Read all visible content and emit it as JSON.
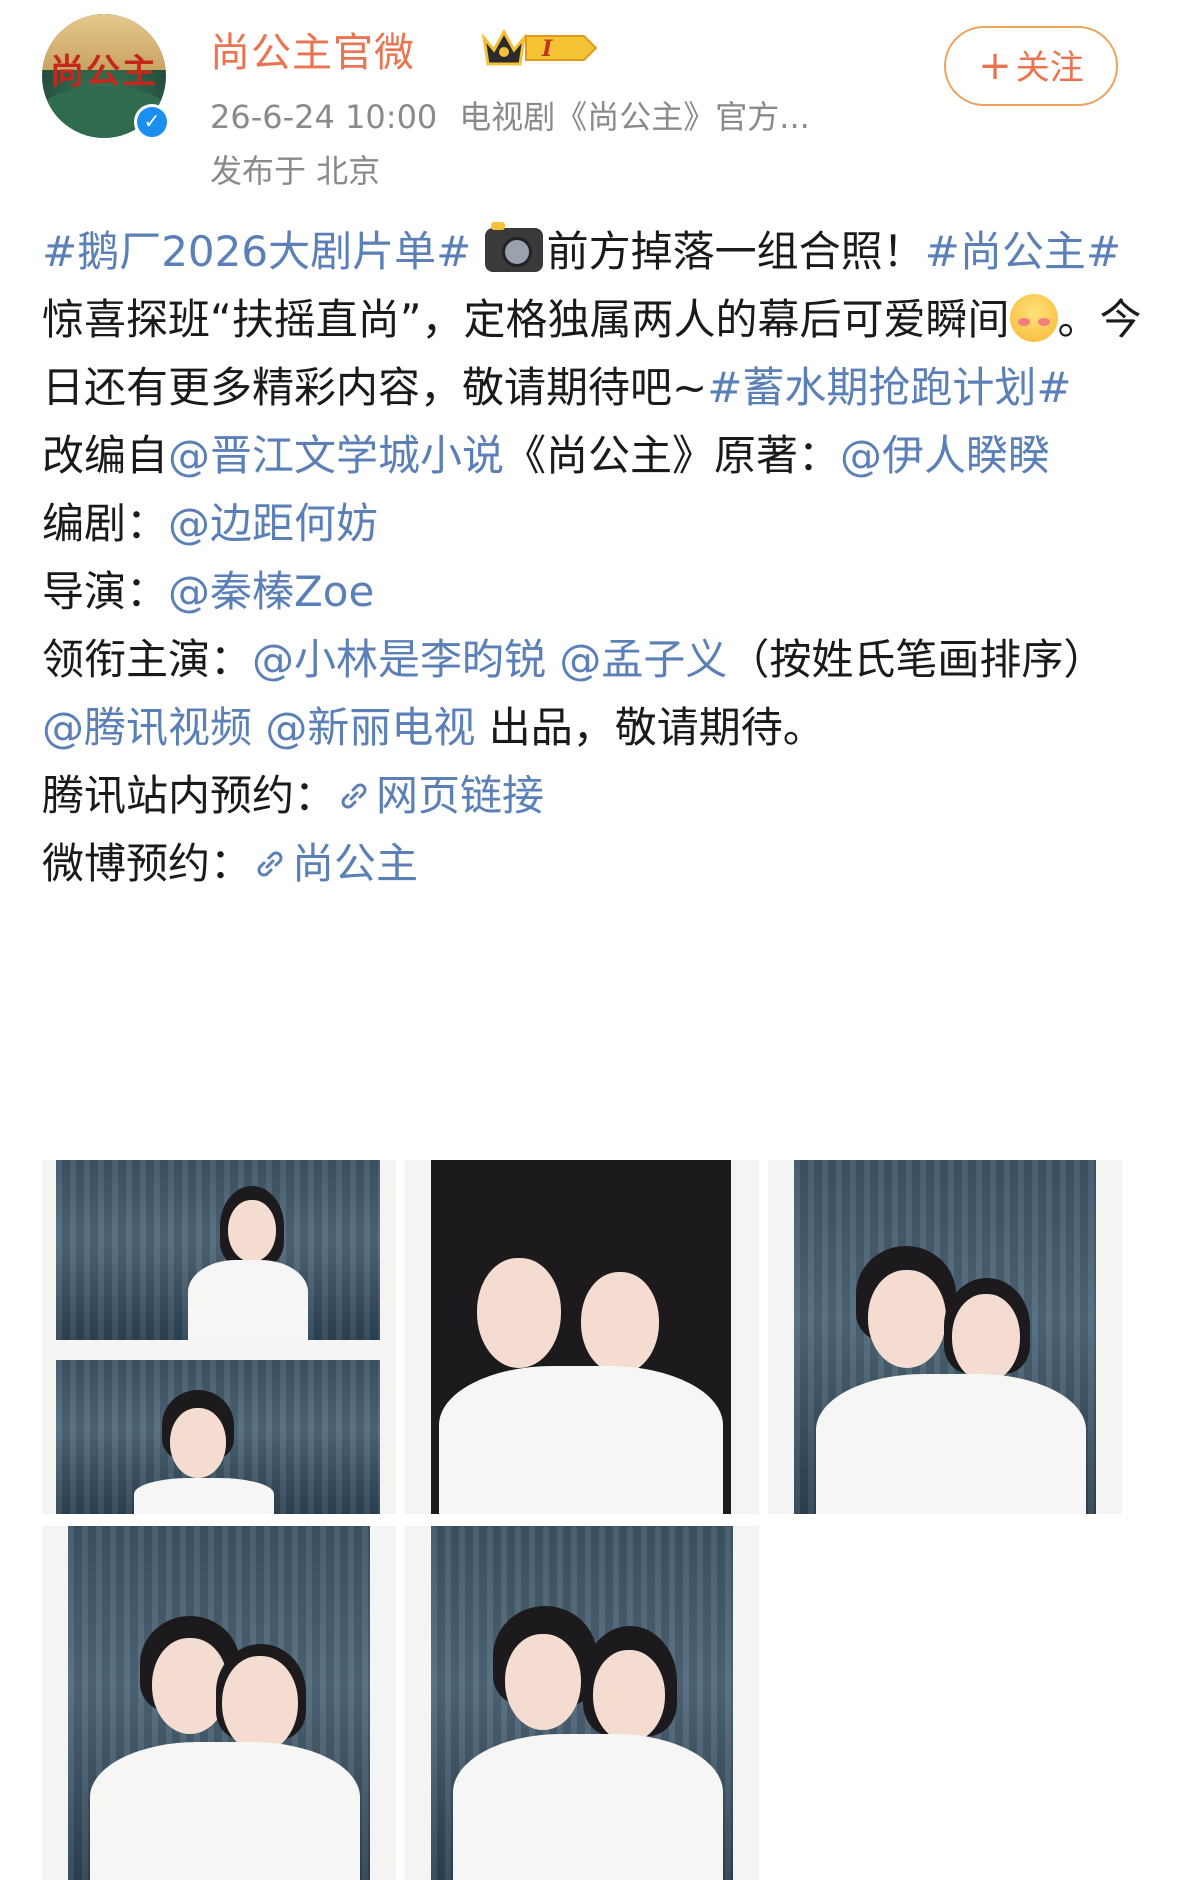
{
  "post": {
    "username": "尚公主官微",
    "avatar_text": "尚公主",
    "time": "26-6-24 10:00",
    "source": "电视剧《尚公主》官方...",
    "location": "发布于 北京",
    "follow_label": "关注",
    "vip_level": "I"
  },
  "content": {
    "l1_tag1": "#鹅厂2026大剧片单#",
    "l1_text": "前方掉落一组合照！",
    "l1_tag2": "#尚公主#",
    "l1_text2": "惊喜探班“扶摇直尚”，定格独属两人的幕后可爱瞬间",
    "l1_text3": "。今日还有更多精彩内容，敬请期待吧~",
    "l1_tag3": "#蓄水期抢跑计划#",
    "adapt_prefix": "改编自",
    "adapt_mention": "@晋江文学城小说",
    "adapt_mid": "《尚公主》原著：",
    "adapt_author": "@伊人睽睽",
    "writer_prefix": "编剧：",
    "writer": "@边距何妨",
    "director_prefix": "导演：",
    "director": "@秦榛Zoe",
    "lead_prefix": "领衔主演：",
    "lead1": "@小林是李昀锐",
    "lead2": "@孟子义",
    "lead_suffix": "（按姓氏笔画排序）",
    "prod1": "@腾讯视频",
    "prod2": "@新丽电视",
    "prod_suffix": " 出品，敬请期待。",
    "tx_prefix": "腾讯站内预约：",
    "tx_link": "网页链接",
    "wb_prefix": "微博预约：",
    "wb_link": "尚公主"
  },
  "icons": {
    "verified": "verified-badge-icon",
    "vip": "crown-vip-icon",
    "camera": "camera-flash-emoji",
    "face": "blushing-face-emoji",
    "link": "link-chain-icon"
  },
  "colors": {
    "accent": "#eb7350",
    "link": "#5b7fb7",
    "meta": "#8a8a8a"
  },
  "photos": [
    "photo-1",
    "photo-2",
    "photo-3",
    "photo-4",
    "photo-5"
  ]
}
